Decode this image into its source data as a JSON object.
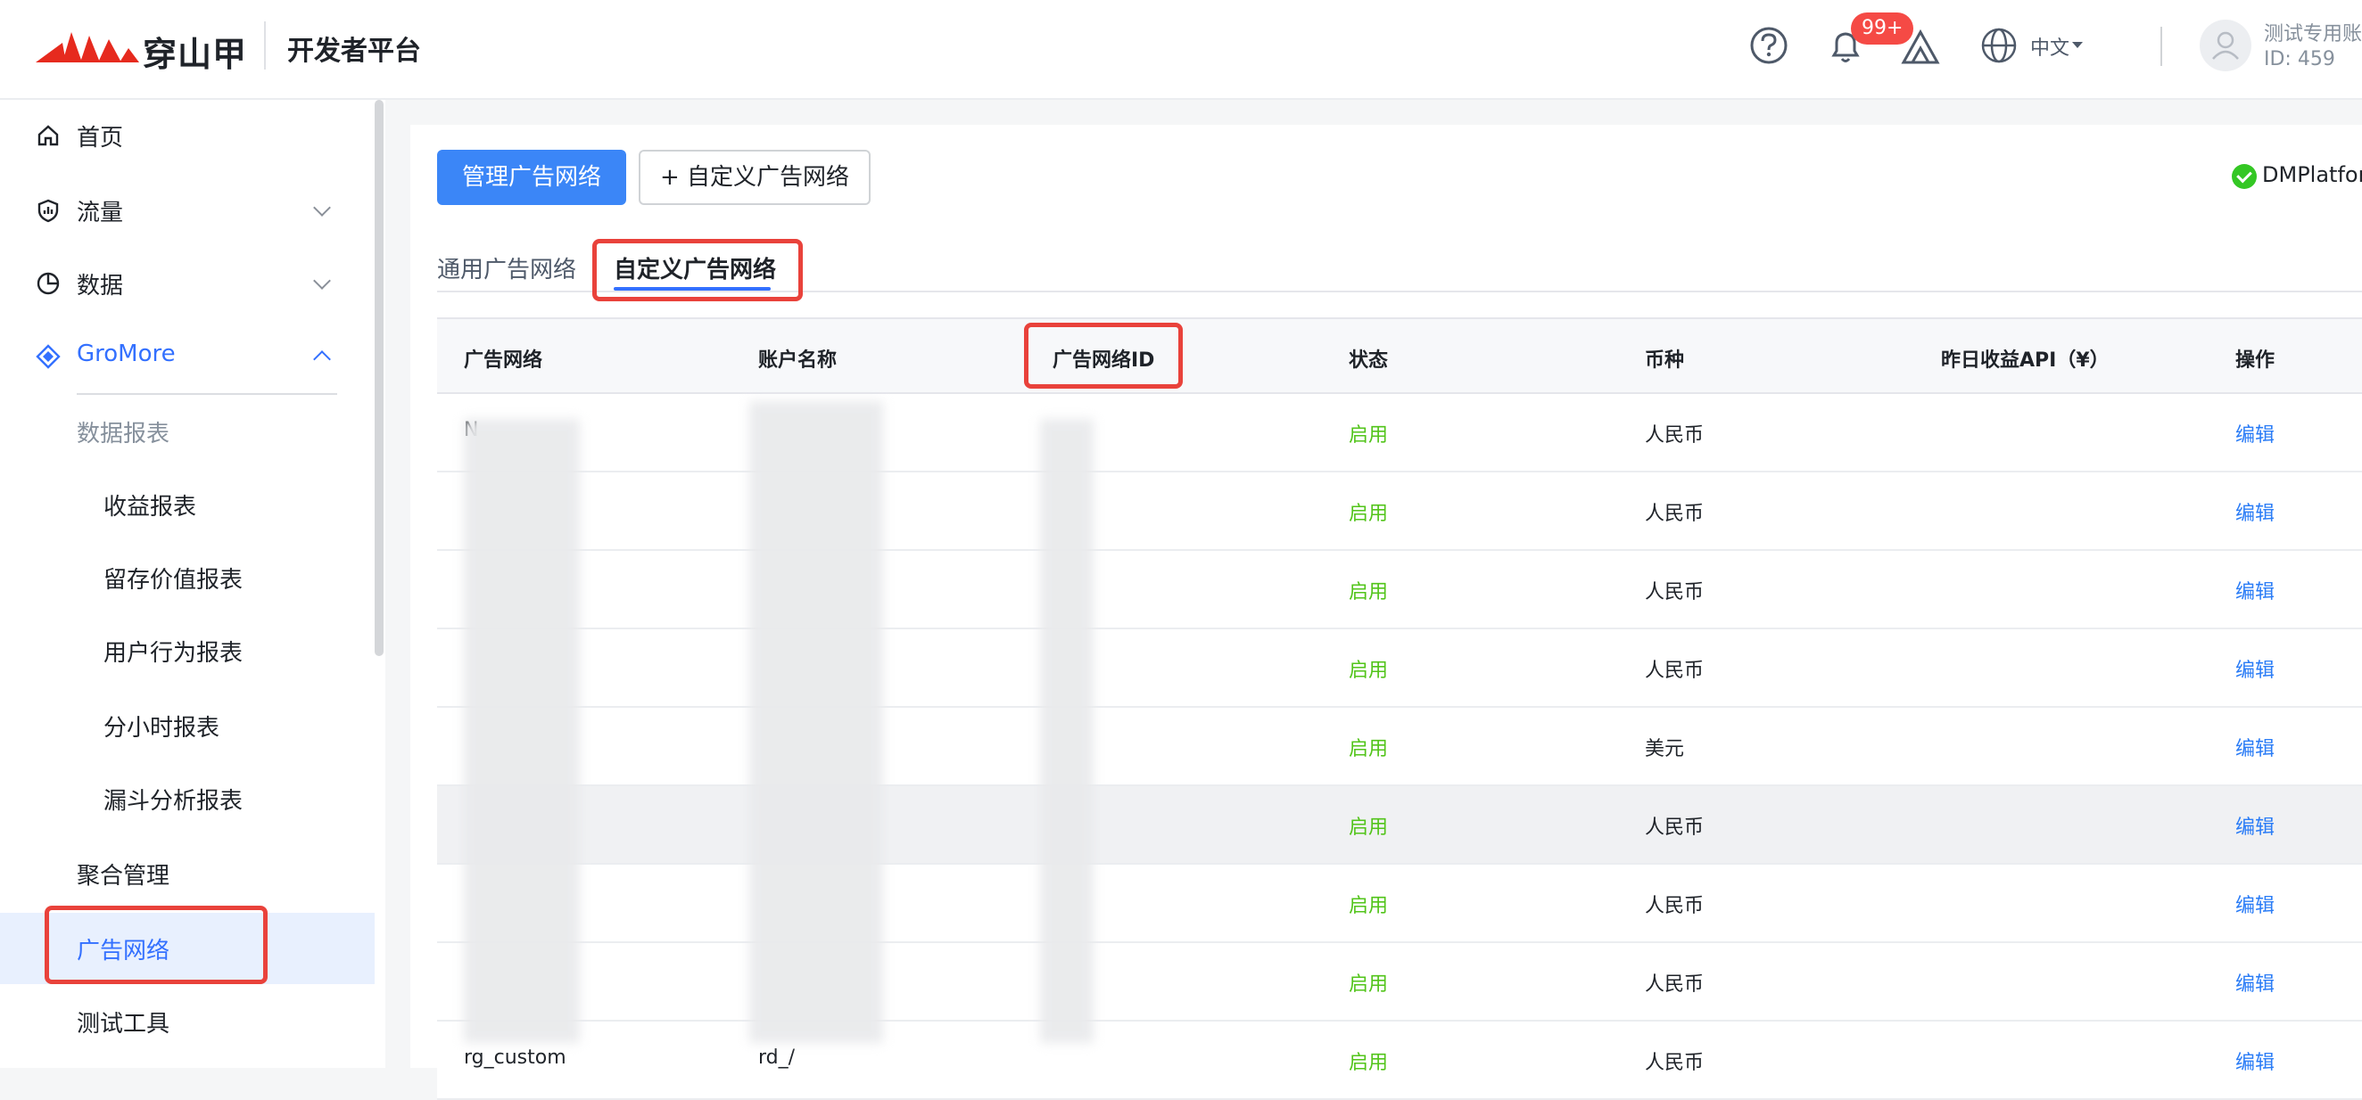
{
  "header": {
    "brand": "穿山甲",
    "platform": "开发者平台",
    "notification_badge": "99+",
    "language": "中文",
    "account_name": "测试专用账",
    "account_id": "ID: 459"
  },
  "sidebar": {
    "items": [
      {
        "label": "首页",
        "icon": "home-icon"
      },
      {
        "label": "流量",
        "icon": "traffic-icon"
      },
      {
        "label": "数据",
        "icon": "pie-chart-icon"
      },
      {
        "label": "GroMore",
        "icon": "gromore-icon"
      }
    ],
    "gromore_children": [
      {
        "label": "数据报表"
      },
      {
        "label": "收益报表"
      },
      {
        "label": "留存价值报表"
      },
      {
        "label": "用户行为报表"
      },
      {
        "label": "分小时报表"
      },
      {
        "label": "漏斗分析报表"
      },
      {
        "label": "聚合管理"
      },
      {
        "label": "广告网络"
      },
      {
        "label": "测试工具"
      }
    ]
  },
  "toolbar": {
    "manage_label": "管理广告网络",
    "add_custom_label": "+ 自定义广告网络",
    "platform_status": "DMPlatforn"
  },
  "tabs": {
    "generic": "通用广告网络",
    "custom": "自定义广告网络"
  },
  "table": {
    "headers": [
      "广告网络",
      "账户名称",
      "广告网络ID",
      "状态",
      "币种",
      "昨日收益API（¥）",
      "操作"
    ],
    "rows": [
      {
        "network": "N",
        "account": "",
        "status": "启用",
        "currency": "人民币",
        "action": "编辑"
      },
      {
        "network": "",
        "account": "",
        "status": "启用",
        "currency": "人民币",
        "action": "编辑"
      },
      {
        "network": "",
        "account": "",
        "status": "启用",
        "currency": "人民币",
        "action": "编辑"
      },
      {
        "network": "",
        "account": "",
        "status": "启用",
        "currency": "人民币",
        "action": "编辑"
      },
      {
        "network": "",
        "account": "",
        "status": "启用",
        "currency": "美元",
        "action": "编辑"
      },
      {
        "network": "",
        "account": "",
        "status": "启用",
        "currency": "人民币",
        "action": "编辑"
      },
      {
        "network": "",
        "account": "",
        "status": "启用",
        "currency": "人民币",
        "action": "编辑"
      },
      {
        "network": "",
        "account": "",
        "status": "启用",
        "currency": "人民币",
        "action": "编辑"
      },
      {
        "network": "rg_custom",
        "account": "rd_/",
        "status": "启用",
        "currency": "人民币",
        "action": "编辑"
      }
    ]
  },
  "colors": {
    "accent": "#3370ff",
    "status_enabled": "#52c41a",
    "highlight_box": "#e9423b",
    "badge": "#f54a45"
  }
}
